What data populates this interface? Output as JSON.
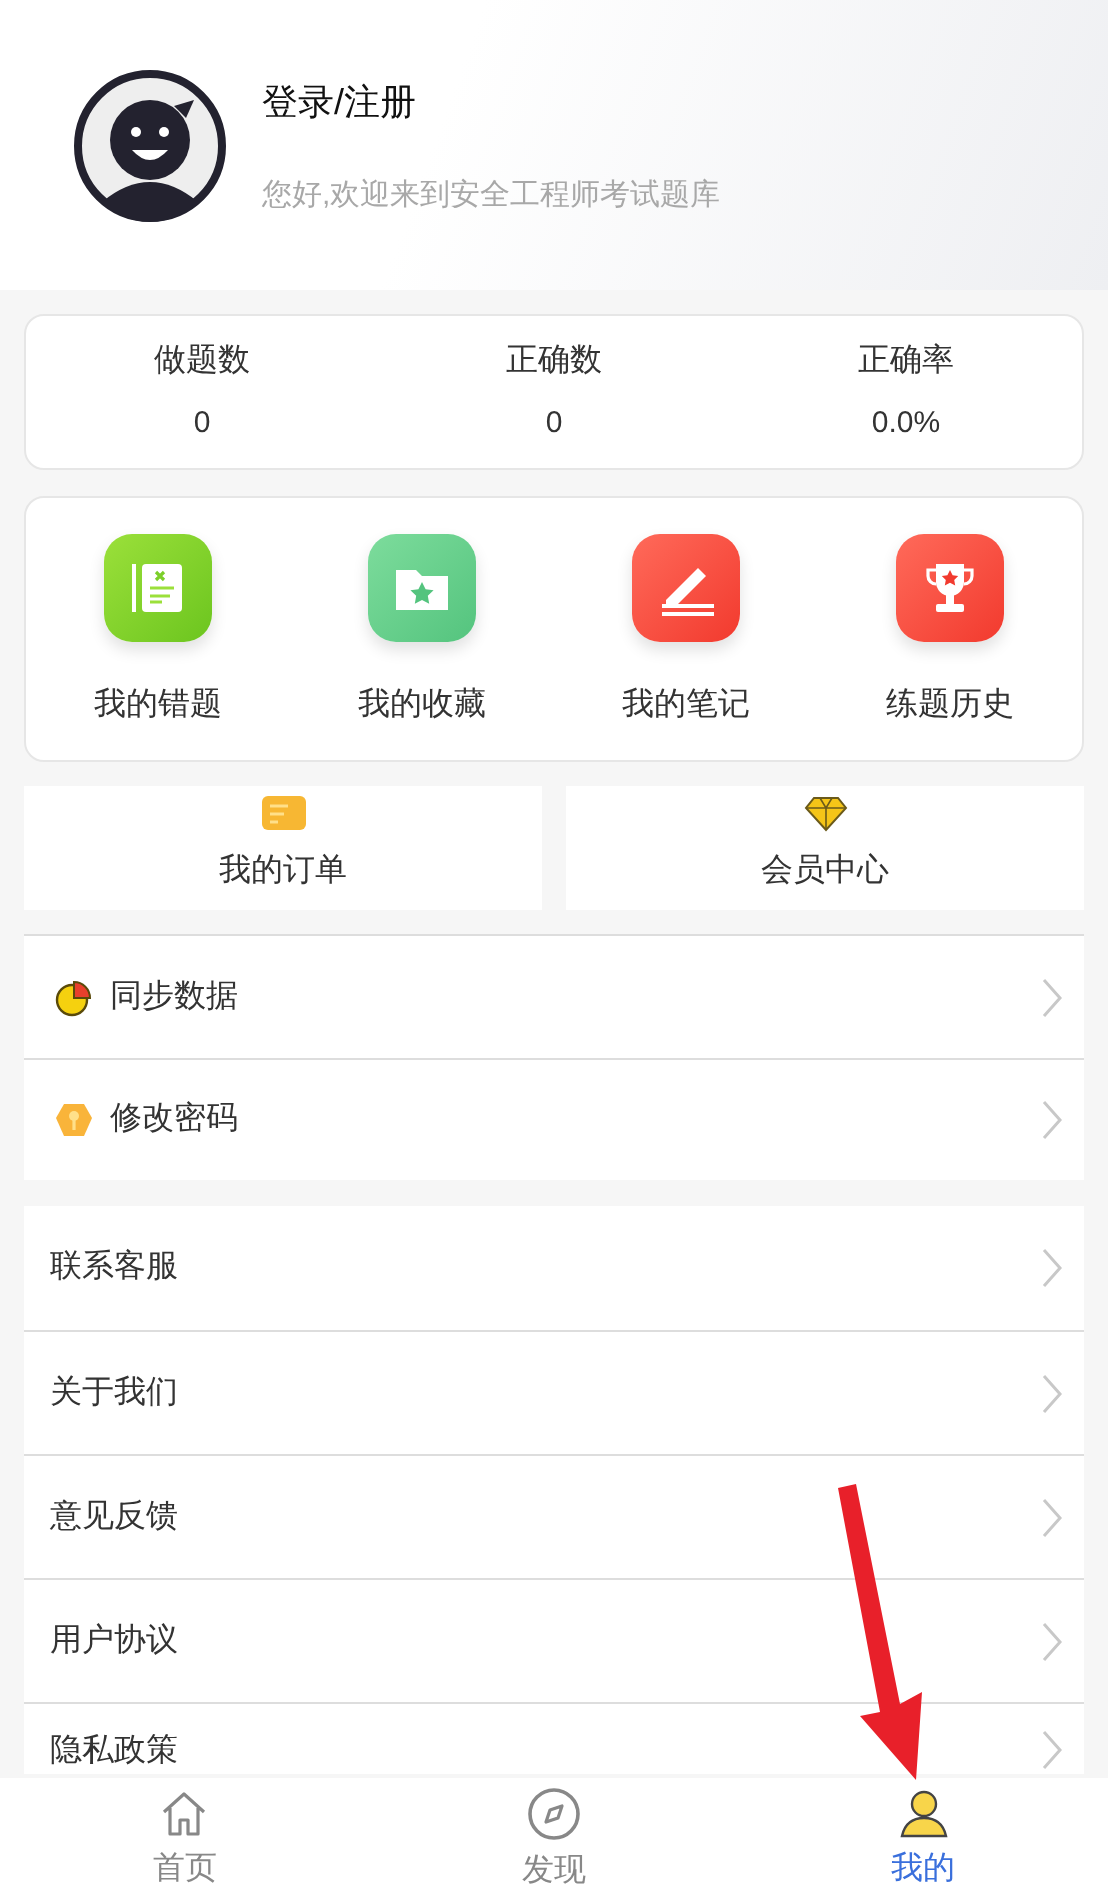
{
  "profile": {
    "title": "登录/注册",
    "subtitle": "您好,欢迎来到安全工程师考试题库"
  },
  "stats": [
    {
      "label": "做题数",
      "value": "0"
    },
    {
      "label": "正确数",
      "value": "0"
    },
    {
      "label": "正确率",
      "value": "0.0%"
    }
  ],
  "shortcuts": [
    {
      "kind": "mistakes",
      "label": "我的错题"
    },
    {
      "kind": "favorites",
      "label": "我的收藏"
    },
    {
      "kind": "notes",
      "label": "我的笔记"
    },
    {
      "kind": "history",
      "label": "练题历史"
    }
  ],
  "cards": [
    {
      "kind": "order",
      "label": "我的订单"
    },
    {
      "kind": "vip",
      "label": "会员中心"
    }
  ],
  "settings": [
    {
      "kind": "sync",
      "label": "同步数据"
    },
    {
      "kind": "password",
      "label": "修改密码"
    }
  ],
  "menu": [
    "联系客服",
    "关于我们",
    "意见反馈",
    "用户协议",
    "隐私政策"
  ],
  "tabbar": [
    {
      "kind": "home",
      "label": "首页",
      "selected": false
    },
    {
      "kind": "discover",
      "label": "发现",
      "selected": false
    },
    {
      "kind": "me",
      "label": "我的",
      "selected": true
    }
  ]
}
